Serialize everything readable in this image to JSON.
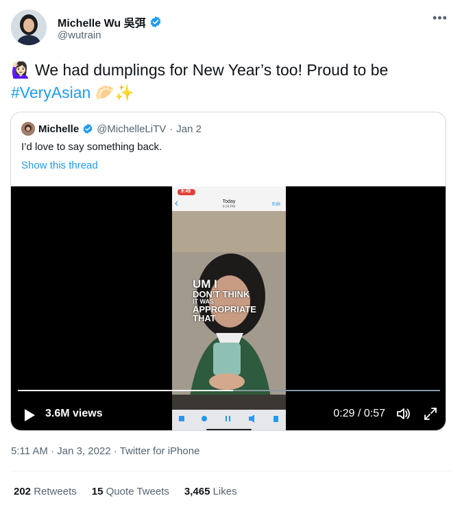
{
  "author": {
    "name": "Michelle Wu 吳弭",
    "handle": "@wutrain"
  },
  "tweet": {
    "emoji_lead": "🙋🏻‍♀️",
    "text": "We had dumplings for New Year’s too! Proud to be",
    "hashtag": "#VeryAsian",
    "emoji_trail": "🥟✨"
  },
  "quoted": {
    "name": "Michelle",
    "handle": "@MichelleLiTV",
    "separator": "·",
    "date": "Jan 2",
    "text": "I’d love to say something back.",
    "show_thread": "Show this thread"
  },
  "video": {
    "views": "3.6M views",
    "time": "0:29 / 0:57",
    "progress_fraction": 0.51,
    "phone_time": "9:49",
    "phone_header": "Today",
    "phone_sub": "9:24 PM",
    "phone_edit": "Edit",
    "caption_lines": [
      "UM I",
      "DON'T THINK",
      "IT WAS",
      "APPROPRIATE",
      "THAT"
    ]
  },
  "meta": {
    "timestamp": "5:11 AM · Jan 3, 2022 · Twitter for iPhone"
  },
  "stats": {
    "retweets_count": "202",
    "retweets_label": "Retweets",
    "quotes_count": "15",
    "quotes_label": "Quote Tweets",
    "likes_count": "3,465",
    "likes_label": "Likes"
  },
  "colors": {
    "accent": "#1d9bf0",
    "muted": "#536471"
  }
}
